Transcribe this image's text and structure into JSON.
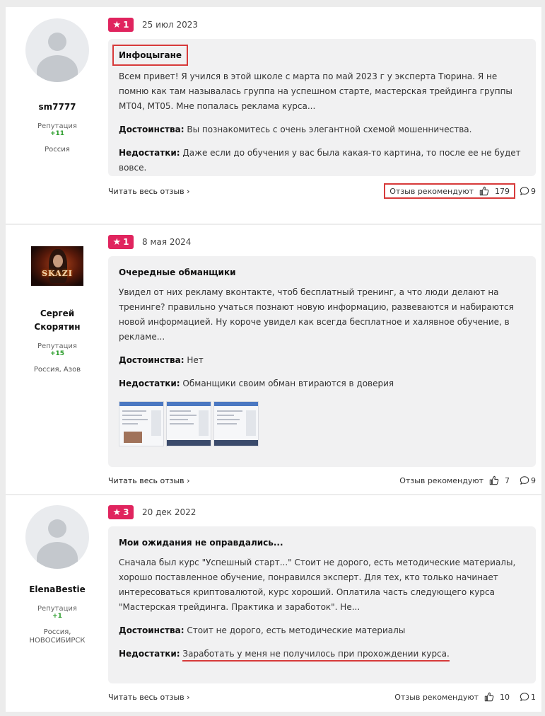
{
  "reviews": [
    {
      "author": {
        "name": "sm7777",
        "rep_label": "Репутация",
        "rep_value": "+11",
        "location": "Россия"
      },
      "rating": "1",
      "date": "25 июл 2023",
      "title": "Инфоцыгане",
      "text": "Всем привет! Я учился в этой школе с марта по май 2023 г у эксперта Тюрина. Я не помню как там называлась группа на успешном старте, мастерская трейдинга группы МТ04, МТ05. Мне попалась реклама курса...",
      "pros_label": "Достоинства:",
      "pros": "Вы познакомитесь с очень элегантной схемой мошенничества.",
      "cons_label": "Недостатки:",
      "cons": "Даже если до обучения у вас была какая-то картина, то после ее не будет вовсе.",
      "read_more": "Читать весь отзыв ›",
      "recommend_label": "Отзыв рекомендуют",
      "likes": "179",
      "comments": "9"
    },
    {
      "author": {
        "name": "Сергей Скорятин",
        "rep_label": "Репутация",
        "rep_value": "+15",
        "location": "Россия, Азов",
        "avatar_text": "SKAZI"
      },
      "rating": "1",
      "date": "8 мая 2024",
      "title": "Очередные обманщики",
      "text": "Увидел от них рекламу вконтакте, чтоб бесплатный тренинг, а что люди делают на тренинге? правильно учаться познают новую информацию, развеваются и набираются новой информацией. Ну короче увидел как всегда бесплатное и халявное обучение, в рекламе...",
      "pros_label": "Достоинства:",
      "pros": "Нет",
      "cons_label": "Недостатки:",
      "cons": "Обманщики своим обман втираются в доверия",
      "read_more": "Читать весь отзыв ›",
      "recommend_label": "Отзыв рекомендуют",
      "likes": "7",
      "comments": "9"
    },
    {
      "author": {
        "name": "ElenaBestie",
        "rep_label": "Репутация",
        "rep_value": "+1",
        "location": "Россия, НОВОСИБИРСК"
      },
      "rating": "3",
      "date": "20 дек 2022",
      "title": "Мои ожидания не оправдались...",
      "text": "Сначала был курс \"Успешный старт...\" Стоит не дорого, есть методические материалы, хорошо поставленное обучение, понравился эксперт. Для тех, кто только начинает интересоваться криптовалютой, курс хороший. Оплатила часть следующего курса \"Мастерская трейдинга. Практика и заработок\". Не...",
      "pros_label": "Достоинства:",
      "pros": "Стоит не дорого, есть методические материалы",
      "cons_label": "Недостатки:",
      "cons": "Заработать у меня не получилось при прохождении курса.",
      "read_more": "Читать весь отзыв ›",
      "recommend_label": "Отзыв рекомендуют",
      "likes": "10",
      "comments": "1"
    }
  ],
  "colors": {
    "rating_badge": "#e0245e",
    "reputation": "#2a9d2a",
    "highlight": "#d73a3a"
  },
  "icons": {
    "star": "star-icon",
    "like": "thumbs-up-icon",
    "comment": "comment-icon",
    "user": "user-placeholder-icon"
  }
}
